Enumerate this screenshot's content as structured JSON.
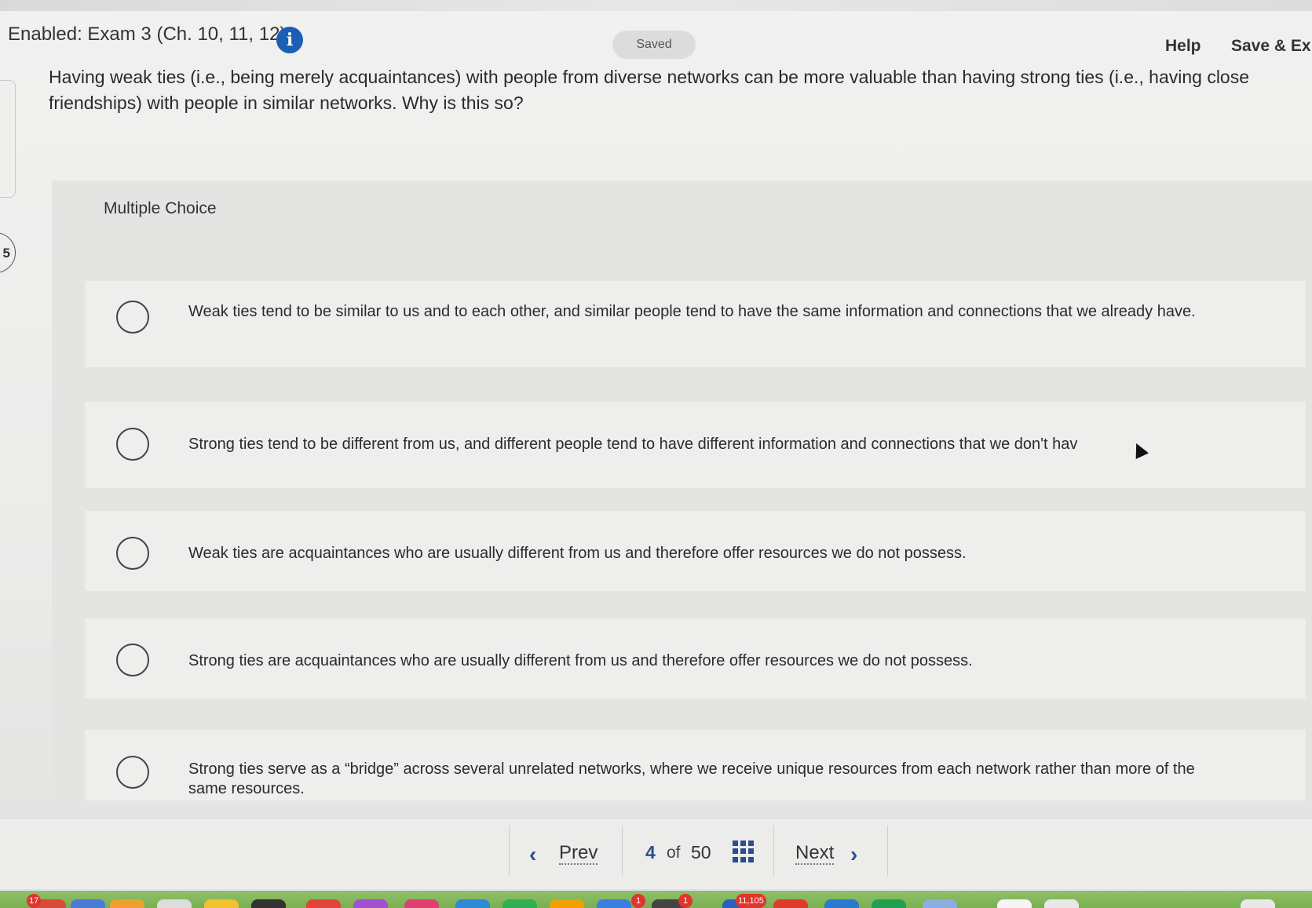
{
  "header": {
    "exam_title": "Enabled: Exam 3 (Ch. 10, 11, 12)",
    "status": "Saved",
    "help_label": "Help",
    "save_exit_label": "Save & Exi"
  },
  "question_number": "5",
  "question": {
    "text": "Having weak ties (i.e., being merely acquaintances) with people from diverse networks can be more valuable than having strong ties (i.e., having close friendships) with people in similar networks. Why is this so?",
    "type_label": "Multiple Choice",
    "choices": [
      {
        "text": "Weak ties tend to be similar to us and to each other, and similar people tend to have the same information and connections that we already have."
      },
      {
        "text": "Strong ties tend to be different from us, and different people tend to have different information and connections that we don't hav"
      },
      {
        "text": "Weak ties are acquaintances who are usually different from us and therefore offer resources we do not possess."
      },
      {
        "text": "Strong ties are acquaintances who are usually different from us and therefore offer resources we do not possess."
      },
      {
        "text": "Strong ties serve as a “bridge” across several unrelated networks, where we receive unique resources from each network rather than more of the same resources."
      }
    ]
  },
  "navigation": {
    "prev_label": "Prev",
    "current_page": "4",
    "of_label": "of",
    "total_pages": "50",
    "next_label": "Next"
  },
  "dock": {
    "badges": [
      "17",
      "1",
      "1",
      "11,105"
    ]
  },
  "colors": {
    "accent": "#1a5fb4",
    "nav_icon": "#2b4e8c",
    "panel": "#e4e4e3"
  }
}
